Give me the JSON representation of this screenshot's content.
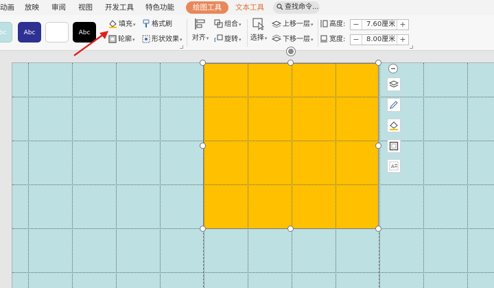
{
  "menubar": {
    "items": [
      "动画",
      "放映",
      "审阅",
      "视图",
      "开发工具",
      "特色功能"
    ],
    "active_tab": "绘图工具",
    "text_tool_tab": "文本工具",
    "search_label": "查找命令..."
  },
  "ribbon": {
    "style_swatches": [
      {
        "label": "Abc",
        "bg": "#bde0e2",
        "fg": "#ffffff"
      },
      {
        "label": "Abc",
        "bg": "#2e3192",
        "fg": "#ffffff"
      },
      {
        "label": "",
        "bg": "#ffffff",
        "fg": "#333333"
      },
      {
        "label": "Abc",
        "bg": "#000000",
        "fg": "#ffffff"
      }
    ],
    "fill_label": "填充",
    "format_painter_label": "格式刷",
    "outline_label": "轮廓",
    "shape_effects_label": "形状效果",
    "align_label": "对齐",
    "group_label": "组合",
    "rotate_label": "旋转",
    "select_label": "选择",
    "bring_forward_label": "上移一层",
    "send_backward_label": "下移一层",
    "height_label": "高度:",
    "height_value": "7.60厘米",
    "width_label": "宽度:",
    "width_value": "8.00厘米",
    "minus": "−",
    "plus": "+"
  },
  "colors": {
    "accent_tab": "#e8885a",
    "slide_bg": "#bde0e2",
    "shape_fill": "#ffc000",
    "arrow_red": "#e02020"
  },
  "icons": [
    "search-icon",
    "fill-bucket-icon",
    "format-painter-icon",
    "outline-icon",
    "shape-effects-icon",
    "align-icon",
    "group-icon",
    "rotate-icon",
    "select-icon",
    "bring-forward-icon",
    "send-backward-icon",
    "height-icon",
    "width-icon",
    "layers-icon",
    "pen-icon",
    "fill-icon",
    "border-icon",
    "text-wrap-icon"
  ]
}
